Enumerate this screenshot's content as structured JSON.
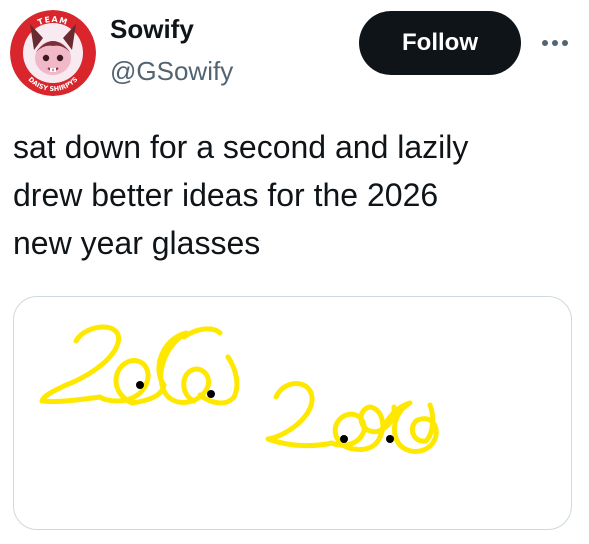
{
  "author": {
    "display_name": "Sowify",
    "handle": "@GSowify",
    "avatar_text_top": "TEAM",
    "avatar_text_bottom": "DAISY SHIRPYS"
  },
  "actions": {
    "follow_label": "Follow",
    "more_icon": "more-horizontal-icon"
  },
  "tweet": {
    "lines": [
      "sat down for a second and lazily",
      "drew better ideas for the 2026",
      "new year glasses"
    ]
  },
  "media": {
    "drawing_text": "2026",
    "ink_color": "#FFE800",
    "pupil_color": "#000000"
  },
  "colors": {
    "text_primary": "#0f1419",
    "text_secondary": "#536471",
    "button_bg": "#0f1419",
    "border": "#cfd9de",
    "avatar_ring": "#d8262c"
  }
}
